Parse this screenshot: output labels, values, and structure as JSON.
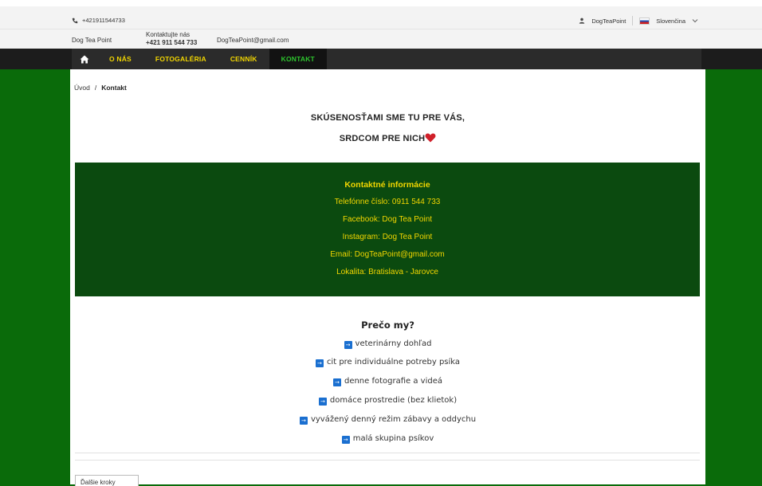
{
  "topbar": {
    "phone": "+421911544733",
    "user": "DogTeaPoint",
    "language": "Slovenčina"
  },
  "infobar": {
    "brand": "Dog Tea Point",
    "contact_label": "Kontaktujte nás",
    "contact_phone": "+421 911 544 733",
    "email": "DogTeaPoint@gmail.com"
  },
  "nav": {
    "items": [
      "O NÁS",
      "FOTOGALÉRIA",
      "CENNÍK",
      "KONTAKT"
    ],
    "active": "KONTAKT"
  },
  "breadcrumb": {
    "home": "Úvod",
    "current": "Kontakt"
  },
  "headline": {
    "line1": "SKÚSENOSŤAMI SME TU PRE VÁS,",
    "line2": "SRDCOM PRE NICH"
  },
  "contact_box": {
    "title": "Kontaktné informácie",
    "phone": "Telefónne číslo: 0911 544 733",
    "facebook": "Facebook: Dog Tea Point",
    "instagram": "Instagram: Dog Tea Point",
    "email": "Email: DogTeaPoint@gmail.com",
    "location": "Lokalita: Bratislava - Jarovce"
  },
  "why": {
    "title": "Prečo my?",
    "items": [
      "veterinárny dohľad",
      "cit pre individuálne potreby psíka",
      "denne fotografie a videá",
      "domáce prostredie (bez klietok)",
      "vyvážený denný režim zábavy a oddychu",
      "malá skupina psíkov"
    ]
  },
  "bottom_button": "Ďalšie kroky",
  "colors": {
    "page_green": "#0a6b0a",
    "box_green": "#0b4a0f",
    "nav_yellow": "#f2d600",
    "nav_active": "#2ec52e",
    "bullet_blue": "#1a6fd0"
  }
}
